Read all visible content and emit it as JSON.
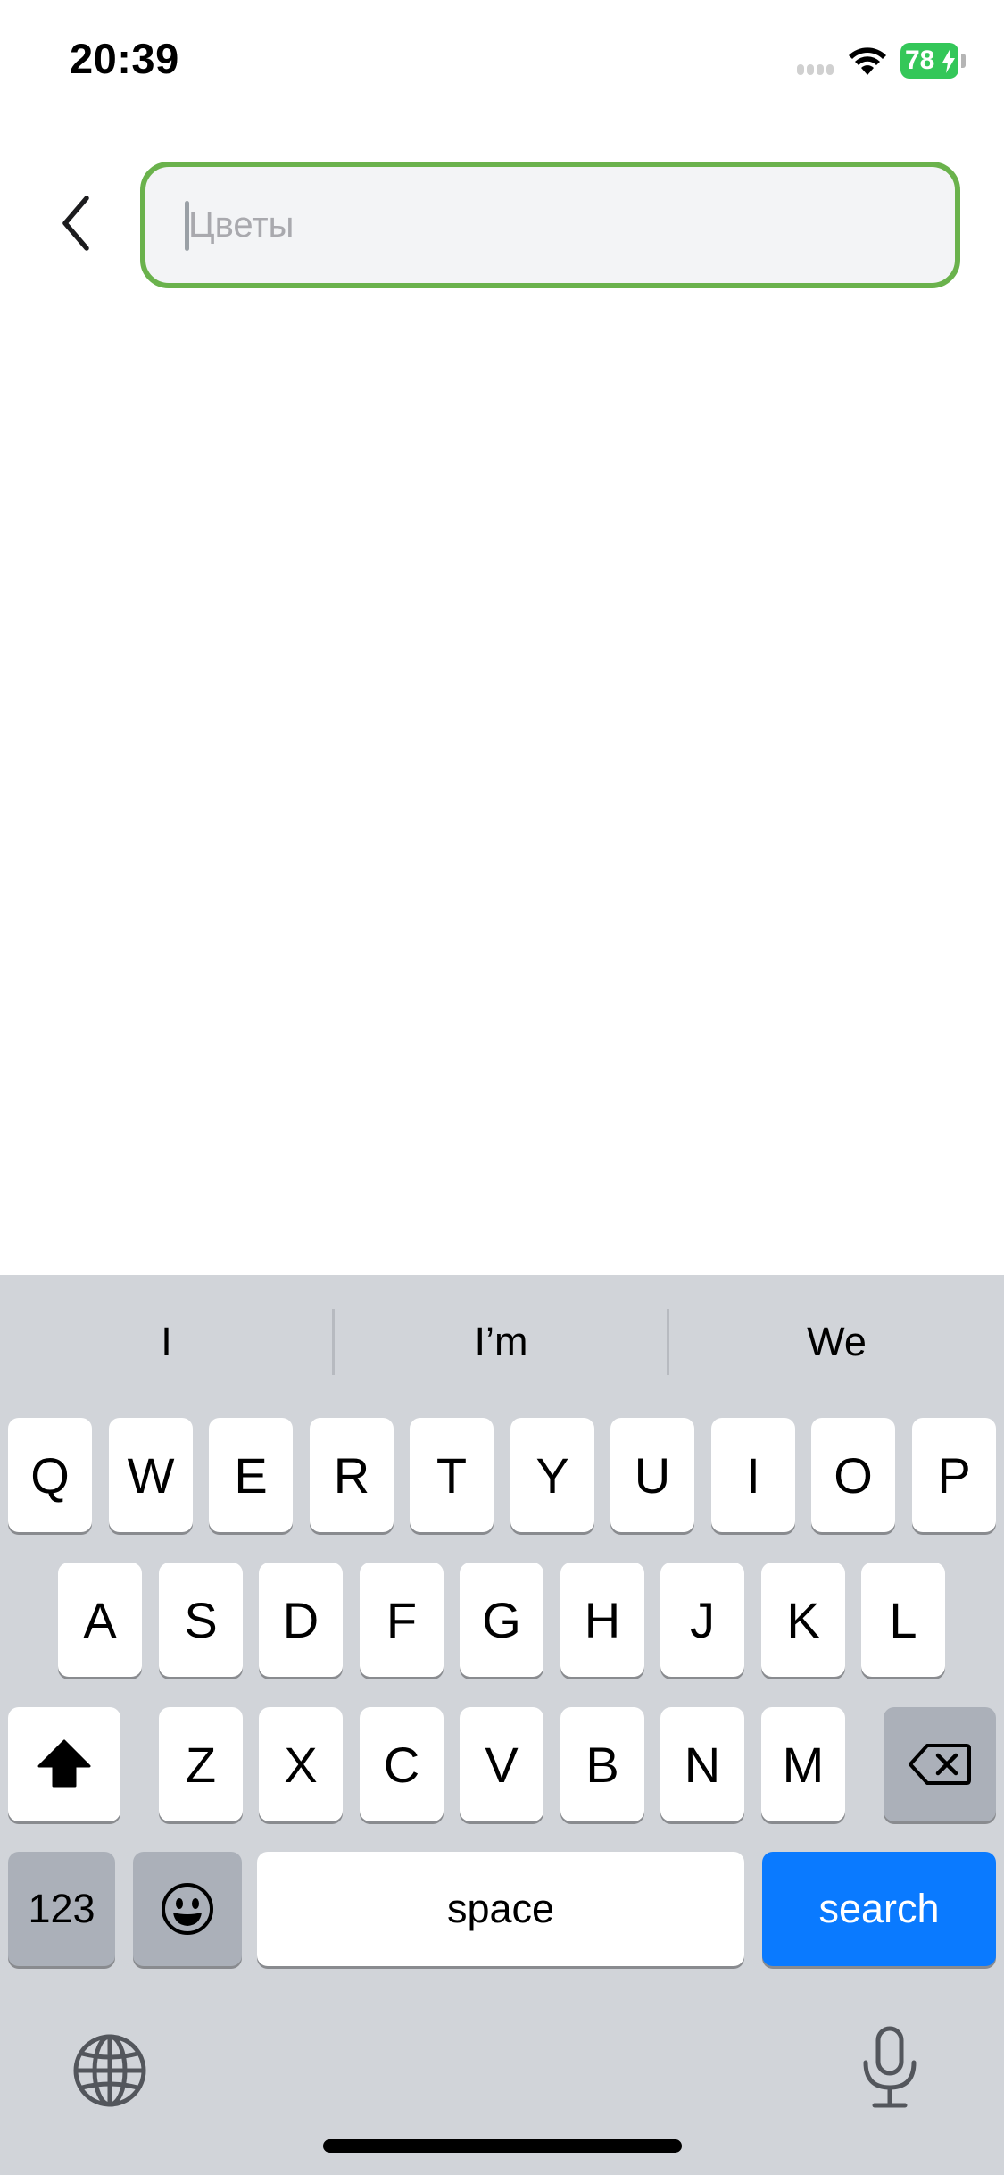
{
  "status_bar": {
    "time": "20:39",
    "battery_level": "78",
    "battery_color": "#34c759",
    "signal_icon": "cellular-signal-icon",
    "wifi_icon": "wifi-icon"
  },
  "header": {
    "back_icon": "chevron-left-icon",
    "search": {
      "placeholder": "Цветы",
      "value": "",
      "border_color": "#6ab24c"
    }
  },
  "keyboard": {
    "suggestions": [
      "I",
      "I’m",
      "We"
    ],
    "row1": [
      "Q",
      "W",
      "E",
      "R",
      "T",
      "Y",
      "U",
      "I",
      "O",
      "P"
    ],
    "row2": [
      "A",
      "S",
      "D",
      "F",
      "G",
      "H",
      "J",
      "K",
      "L"
    ],
    "row3": [
      "Z",
      "X",
      "C",
      "V",
      "B",
      "N",
      "M"
    ],
    "shift_icon": "shift-icon",
    "delete_icon": "delete-icon",
    "numbers_label": "123",
    "emoji_icon": "emoji-icon",
    "space_label": "space",
    "search_label": "search",
    "search_color": "#0a7aff",
    "globe_icon": "globe-icon",
    "mic_icon": "microphone-icon"
  }
}
